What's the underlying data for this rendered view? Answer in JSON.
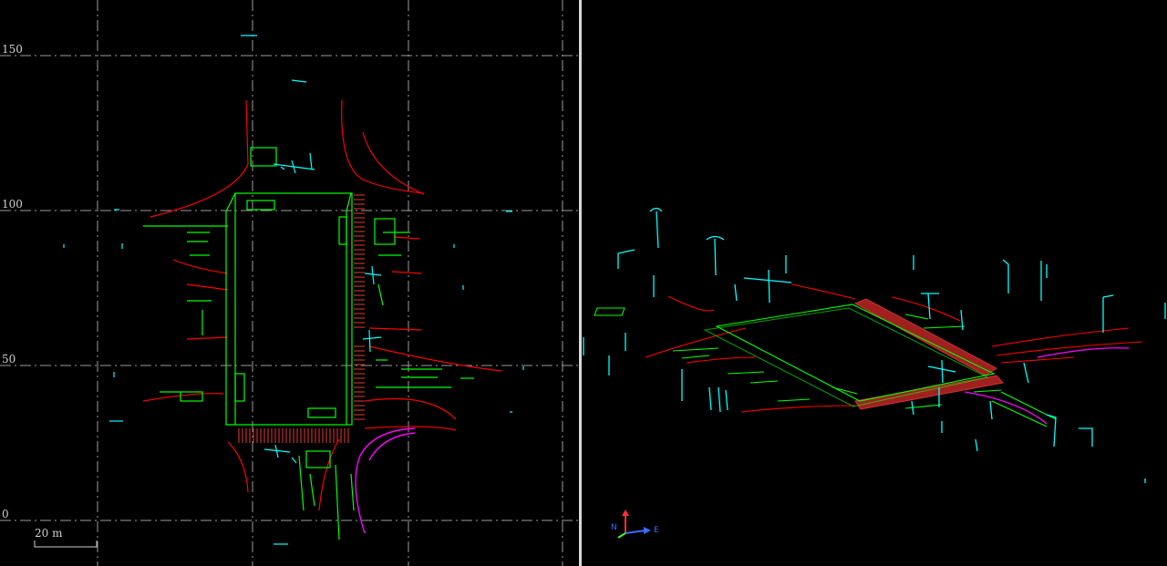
{
  "top_view": {
    "y_axis_labels": [
      "150",
      "100",
      "50",
      "0"
    ],
    "scale_bar_label": "20 m"
  },
  "perspective_view": {
    "axis_gizmo": {
      "north_label": "N",
      "east_label": "E"
    }
  },
  "colors": {
    "lane_boundary": "#00ff00",
    "road_edge": "#ff0000",
    "crosswalk": "#c03030",
    "poles_signs": "#00ffff",
    "special_lane": "#ff00ff",
    "grid": "#cfcfcf",
    "divider": "#d8d8d8"
  }
}
